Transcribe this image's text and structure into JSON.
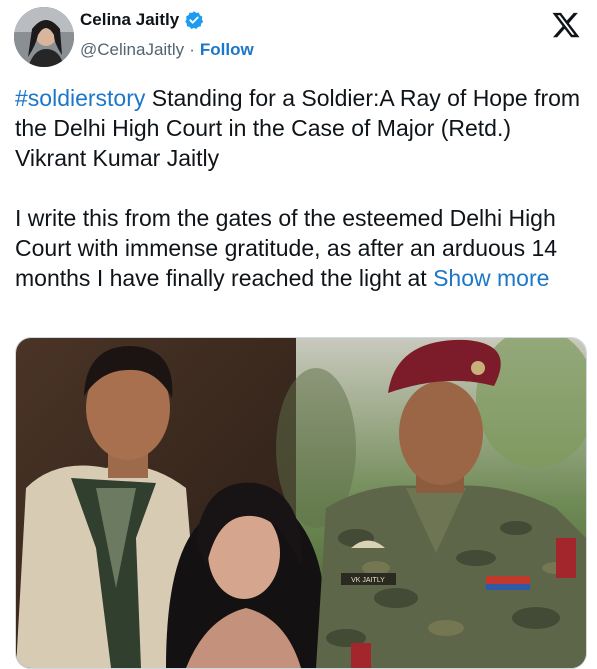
{
  "author": {
    "name": "Celina Jaitly",
    "handle": "@CelinaJaitly",
    "separator": "·",
    "follow_label": "Follow",
    "verified_color": "#1d9bf0"
  },
  "brand": {
    "logo": "x-logo-icon"
  },
  "tweet": {
    "hashtag": "#soldierstory",
    "line1_rest": " Standing for a Soldier:A Ray of Hope from the Delhi High Court in the Case of Major (Retd.) Vikrant Kumar Jaitly",
    "paragraph2": "I write this from the gates of the esteemed Delhi High Court with immense gratitude, as after an arduous 14 months I have finally reached the light at ",
    "show_more": "Show more"
  },
  "media": {
    "name_tag": "VK JAITLY",
    "link_color": "#1d77c9"
  }
}
